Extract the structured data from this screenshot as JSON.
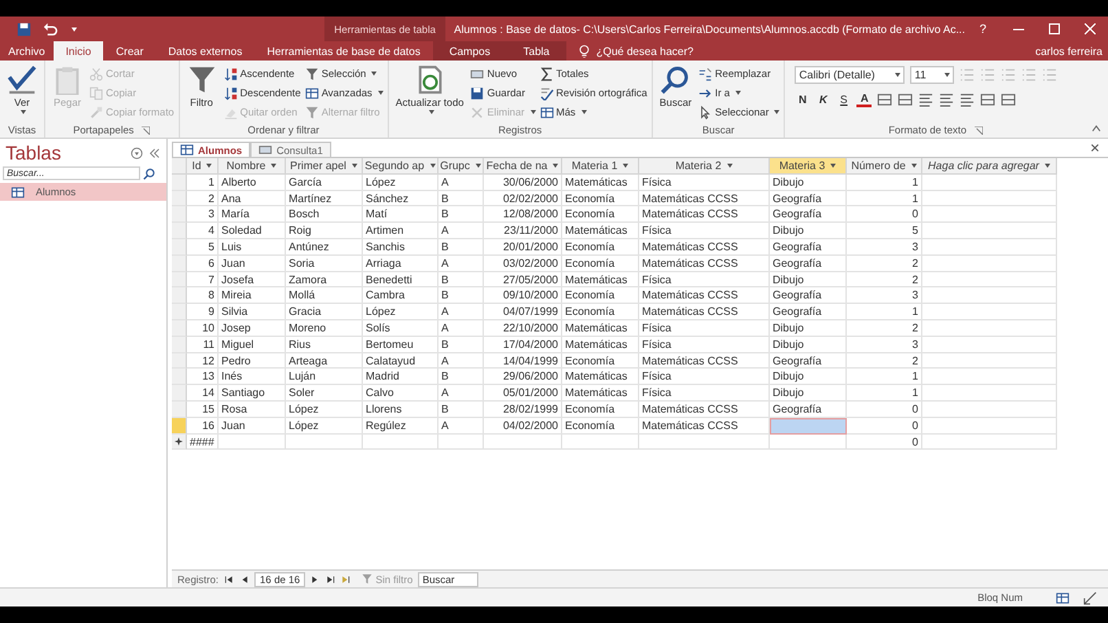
{
  "title_bar": {
    "context_label": "Herramientas de tabla",
    "title": "Alumnos : Base de datos- C:\\Users\\Carlos Ferreira\\Documents\\Alumnos.accdb (Formato de archivo Ac...",
    "help": "?"
  },
  "ribbon_tabs": [
    {
      "label": "Archivo",
      "selected": false,
      "kind": "file"
    },
    {
      "label": "Inicio",
      "selected": true,
      "kind": "main"
    },
    {
      "label": "Crear",
      "selected": false,
      "kind": "main"
    },
    {
      "label": "Datos externos",
      "selected": false,
      "kind": "main"
    },
    {
      "label": "Herramientas de base de datos",
      "selected": false,
      "kind": "main"
    },
    {
      "label": "Campos",
      "selected": false,
      "kind": "context"
    },
    {
      "label": "Tabla",
      "selected": false,
      "kind": "context"
    }
  ],
  "tell_me": {
    "placeholder": "¿Qué desea hacer?"
  },
  "user": "carlos ferreira",
  "ribbon_groups": [
    {
      "label": "Vistas",
      "launcher": false,
      "columns": [
        [
          {
            "label": "Ver",
            "kind": "large",
            "disabled": false,
            "dropdown": true
          }
        ]
      ]
    },
    {
      "label": "Portapapeles",
      "launcher": true,
      "columns": [
        [
          {
            "label": "Pegar",
            "kind": "large",
            "disabled": true,
            "dropdown": false
          }
        ],
        [
          {
            "label": "Cortar",
            "kind": "small",
            "disabled": true,
            "dropdown": false
          },
          {
            "label": "Copiar",
            "kind": "small",
            "disabled": true,
            "dropdown": false
          },
          {
            "label": "Copiar formato",
            "kind": "small",
            "disabled": true,
            "dropdown": false
          }
        ]
      ]
    },
    {
      "label": "Ordenar y filtrar",
      "launcher": false,
      "columns": [
        [
          {
            "label": "Filtro",
            "kind": "large",
            "disabled": false,
            "dropdown": false
          }
        ],
        [
          {
            "label": "Ascendente",
            "kind": "small",
            "disabled": false,
            "dropdown": false
          },
          {
            "label": "Descendente",
            "kind": "small",
            "disabled": false,
            "dropdown": false
          },
          {
            "label": "Quitar orden",
            "kind": "small",
            "disabled": true,
            "dropdown": false
          }
        ],
        [
          {
            "label": "Selección",
            "kind": "small",
            "disabled": false,
            "dropdown": true
          },
          {
            "label": "Avanzadas",
            "kind": "small",
            "disabled": false,
            "dropdown": true
          },
          {
            "label": "Alternar filtro",
            "kind": "small",
            "disabled": true,
            "dropdown": false
          }
        ]
      ]
    },
    {
      "label": "Registros",
      "launcher": false,
      "columns": [
        [
          {
            "label": "Actualizar todo",
            "kind": "large",
            "disabled": false,
            "dropdown": true
          }
        ],
        [
          {
            "label": "Nuevo",
            "kind": "small",
            "disabled": false,
            "dropdown": false
          },
          {
            "label": "Guardar",
            "kind": "small",
            "disabled": false,
            "dropdown": false
          },
          {
            "label": "Eliminar",
            "kind": "small",
            "disabled": true,
            "dropdown": true
          }
        ],
        [
          {
            "label": "Totales",
            "kind": "small",
            "disabled": false,
            "dropdown": false
          },
          {
            "label": "Revisión ortográfica",
            "kind": "small",
            "disabled": false,
            "dropdown": false
          },
          {
            "label": "Más",
            "kind": "small",
            "disabled": false,
            "dropdown": true
          }
        ]
      ]
    },
    {
      "label": "Buscar",
      "launcher": false,
      "columns": [
        [
          {
            "label": "Buscar",
            "kind": "large",
            "disabled": false,
            "dropdown": false
          }
        ],
        [
          {
            "label": "Reemplazar",
            "kind": "small",
            "disabled": false,
            "dropdown": false
          },
          {
            "label": "Ir a",
            "kind": "small",
            "disabled": false,
            "dropdown": true
          },
          {
            "label": "Seleccionar",
            "kind": "small",
            "disabled": false,
            "dropdown": true
          }
        ]
      ]
    }
  ],
  "text_format": {
    "label": "Formato de texto",
    "launcher": true,
    "font": "Calibri (Detalle)",
    "size": "11",
    "buttons": [
      {
        "label": "N",
        "kind": "bold"
      },
      {
        "label": "K",
        "kind": "italic"
      },
      {
        "label": "S",
        "kind": "underline"
      }
    ],
    "font_color": "A"
  },
  "nav_pane": {
    "title": "Tablas",
    "search": {
      "placeholder": "Buscar..."
    },
    "items": [
      {
        "label": "Alumnos",
        "selected": true
      }
    ]
  },
  "doc_tabs": [
    {
      "label": "Alumnos",
      "selected": true,
      "kind": "table"
    },
    {
      "label": "Consulta1",
      "selected": false,
      "kind": "query"
    }
  ],
  "table": {
    "columns": [
      {
        "label": "Id",
        "kind": "number",
        "selected": false
      },
      {
        "label": "Nombre",
        "kind": "text",
        "selected": false
      },
      {
        "label": "Primer apel",
        "kind": "text",
        "selected": false
      },
      {
        "label": "Segundo ap",
        "kind": "text",
        "selected": false
      },
      {
        "label": "Grupc",
        "kind": "text",
        "selected": false
      },
      {
        "label": "Fecha de na",
        "kind": "date",
        "selected": false
      },
      {
        "label": "Materia 1",
        "kind": "text",
        "selected": false
      },
      {
        "label": "Materia 2",
        "kind": "text",
        "selected": false
      },
      {
        "label": "Materia 3",
        "kind": "text",
        "selected": true
      },
      {
        "label": "Número de",
        "kind": "number",
        "selected": false
      },
      {
        "label": "Haga clic para agregar",
        "kind": "add",
        "selected": false
      }
    ],
    "rows": [
      {
        "selected": false,
        "cells": [
          "1",
          "Alberto",
          "García",
          "López",
          "A",
          "30/06/2000",
          "Matemáticas",
          "Física",
          "Dibujo",
          "1"
        ]
      },
      {
        "selected": false,
        "cells": [
          "2",
          "Ana",
          "Martínez",
          "Sánchez",
          "B",
          "02/02/2000",
          "Economía",
          "Matemáticas CCSS",
          "Geografía",
          "1"
        ]
      },
      {
        "selected": false,
        "cells": [
          "3",
          "María",
          "Bosch",
          "Matí",
          "B",
          "12/08/2000",
          "Economía",
          "Matemáticas CCSS",
          "Geografía",
          "0"
        ]
      },
      {
        "selected": false,
        "cells": [
          "4",
          "Soledad",
          "Roig",
          "Artimen",
          "A",
          "23/11/2000",
          "Matemáticas",
          "Física",
          "Dibujo",
          "5"
        ]
      },
      {
        "selected": false,
        "cells": [
          "5",
          "Luis",
          "Antúnez",
          "Sanchis",
          "B",
          "20/01/2000",
          "Economía",
          "Matemáticas CCSS",
          "Geografía",
          "3"
        ]
      },
      {
        "selected": false,
        "cells": [
          "6",
          "Juan",
          "Soria",
          "Arriaga",
          "A",
          "03/02/2000",
          "Economía",
          "Matemáticas CCSS",
          "Geografía",
          "2"
        ]
      },
      {
        "selected": false,
        "cells": [
          "7",
          "Josefa",
          "Zamora",
          "Benedetti",
          "B",
          "27/05/2000",
          "Matemáticas",
          "Física",
          "Dibujo",
          "2"
        ]
      },
      {
        "selected": false,
        "cells": [
          "8",
          "Mireia",
          "Mollá",
          "Cambra",
          "B",
          "09/10/2000",
          "Economía",
          "Matemáticas CCSS",
          "Geografía",
          "3"
        ]
      },
      {
        "selected": false,
        "cells": [
          "9",
          "Silvia",
          "Gracia",
          "López",
          "A",
          "04/07/1999",
          "Economía",
          "Matemáticas CCSS",
          "Geografía",
          "1"
        ]
      },
      {
        "selected": false,
        "cells": [
          "10",
          "Josep",
          "Moreno",
          "Solís",
          "A",
          "22/10/2000",
          "Matemáticas",
          "Física",
          "Dibujo",
          "2"
        ]
      },
      {
        "selected": false,
        "cells": [
          "11",
          "Miguel",
          "Rius",
          "Bertomeu",
          "B",
          "17/04/2000",
          "Matemáticas",
          "Física",
          "Dibujo",
          "3"
        ]
      },
      {
        "selected": false,
        "cells": [
          "12",
          "Pedro",
          "Arteaga",
          "Calatayud",
          "A",
          "14/04/1999",
          "Economía",
          "Matemáticas CCSS",
          "Geografía",
          "2"
        ]
      },
      {
        "selected": false,
        "cells": [
          "13",
          "Inés",
          "Luján",
          "Madrid",
          "B",
          "29/06/2000",
          "Matemáticas",
          "Física",
          "Dibujo",
          "1"
        ]
      },
      {
        "selected": false,
        "cells": [
          "14",
          "Santiago",
          "Soler",
          "Calvo",
          "A",
          "05/01/2000",
          "Matemáticas",
          "Física",
          "Dibujo",
          "1"
        ]
      },
      {
        "selected": false,
        "cells": [
          "15",
          "Rosa",
          "López",
          "Llorens",
          "B",
          "28/02/1999",
          "Economía",
          "Matemáticas CCSS",
          "Geografía",
          "0"
        ]
      },
      {
        "selected": true,
        "cells": [
          "16",
          "Juan",
          "López",
          "Regúlez",
          "A",
          "04/02/2000",
          "Economía",
          "Matemáticas CCSS",
          null,
          "0"
        ]
      }
    ],
    "new_row": {
      "id": "####",
      "count": "0"
    }
  },
  "record_nav": {
    "label": "Registro:",
    "position": "16 de 16",
    "filter": "Sin filtro",
    "search": {
      "placeholder": "Buscar"
    }
  },
  "status_bar": {
    "text": "Bloq Num"
  }
}
